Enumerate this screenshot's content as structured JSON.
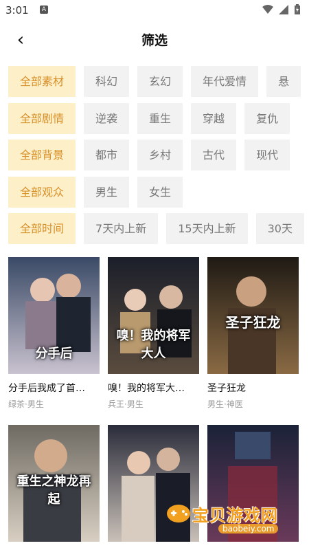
{
  "status": {
    "time": "3:01",
    "notif": "A"
  },
  "header": {
    "back_icon": "back-arrow-icon",
    "title": "筛选"
  },
  "filters": [
    [
      "全部素材",
      "科幻",
      "玄幻",
      "年代爱情",
      "悬"
    ],
    [
      "全部剧情",
      "逆袭",
      "重生",
      "穿越",
      "复仇"
    ],
    [
      "全部背景",
      "都市",
      "乡村",
      "古代",
      "现代"
    ],
    [
      "全部观众",
      "男生",
      "女生"
    ],
    [
      "全部时间",
      "7天内上新",
      "15天内上新",
      "30天"
    ]
  ],
  "cards": [
    {
      "title": "分手后我成了首…",
      "tags": "绿茶·男生",
      "poster_text": "分手后",
      "bg1": "#3a4a66",
      "bg2": "#c9c2cf"
    },
    {
      "title": "嗅！我的将军大…",
      "tags": "兵王·男生",
      "poster_text": "嗅！我的将军大人",
      "bg1": "#1b1f2a",
      "bg2": "#5a4c3e"
    },
    {
      "title": "圣子狂龙",
      "tags": "男生·神医",
      "poster_text": "圣子狂龙",
      "bg1": "#1f1a14",
      "bg2": "#8a6a44"
    },
    {
      "title": "",
      "tags": "",
      "poster_text": "重生之神龙再起",
      "bg1": "#6e6a62",
      "bg2": "#d8cfc2"
    },
    {
      "title": "",
      "tags": "",
      "poster_text": "",
      "bg1": "#2a2c3a",
      "bg2": "#c9c0b8"
    },
    {
      "title": "",
      "tags": "",
      "poster_text": "",
      "bg1": "#1a2238",
      "bg2": "#6a3a5a"
    }
  ],
  "watermark": {
    "text": "宝贝游戏网",
    "url": "baobeiy.com"
  }
}
